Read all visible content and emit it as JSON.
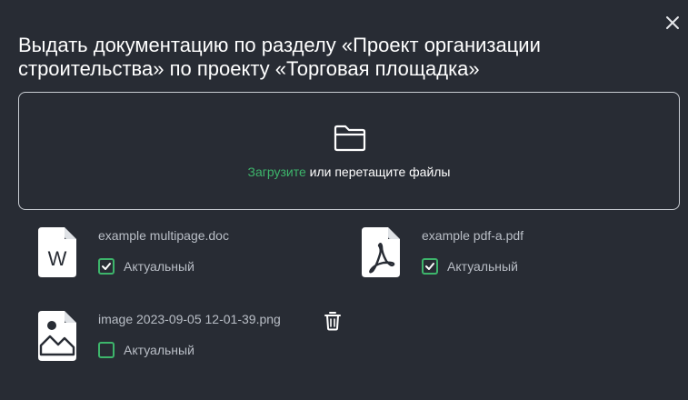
{
  "title": "Выдать документацию по разделу «Проект организации строительства» по проекту «Торговая площадка»",
  "dropzone": {
    "upload_link": "Загрузите",
    "text": "или  перетащите файлы"
  },
  "files": [
    {
      "name": "example multipage.doc",
      "icon": "word-file-icon",
      "status_label": "Актуальный",
      "checked": true
    },
    {
      "name": "example pdf-a.pdf",
      "icon": "pdf-file-icon",
      "status_label": "Актуальный",
      "checked": true
    },
    {
      "name": "image 2023-09-05 12-01-39.png",
      "icon": "image-file-icon",
      "status_label": "Актуальный",
      "checked": false
    }
  ],
  "colors": {
    "background": "#282c34",
    "accent": "#3db56b",
    "text": "#ffffff",
    "muted_text": "#b9bec6"
  }
}
